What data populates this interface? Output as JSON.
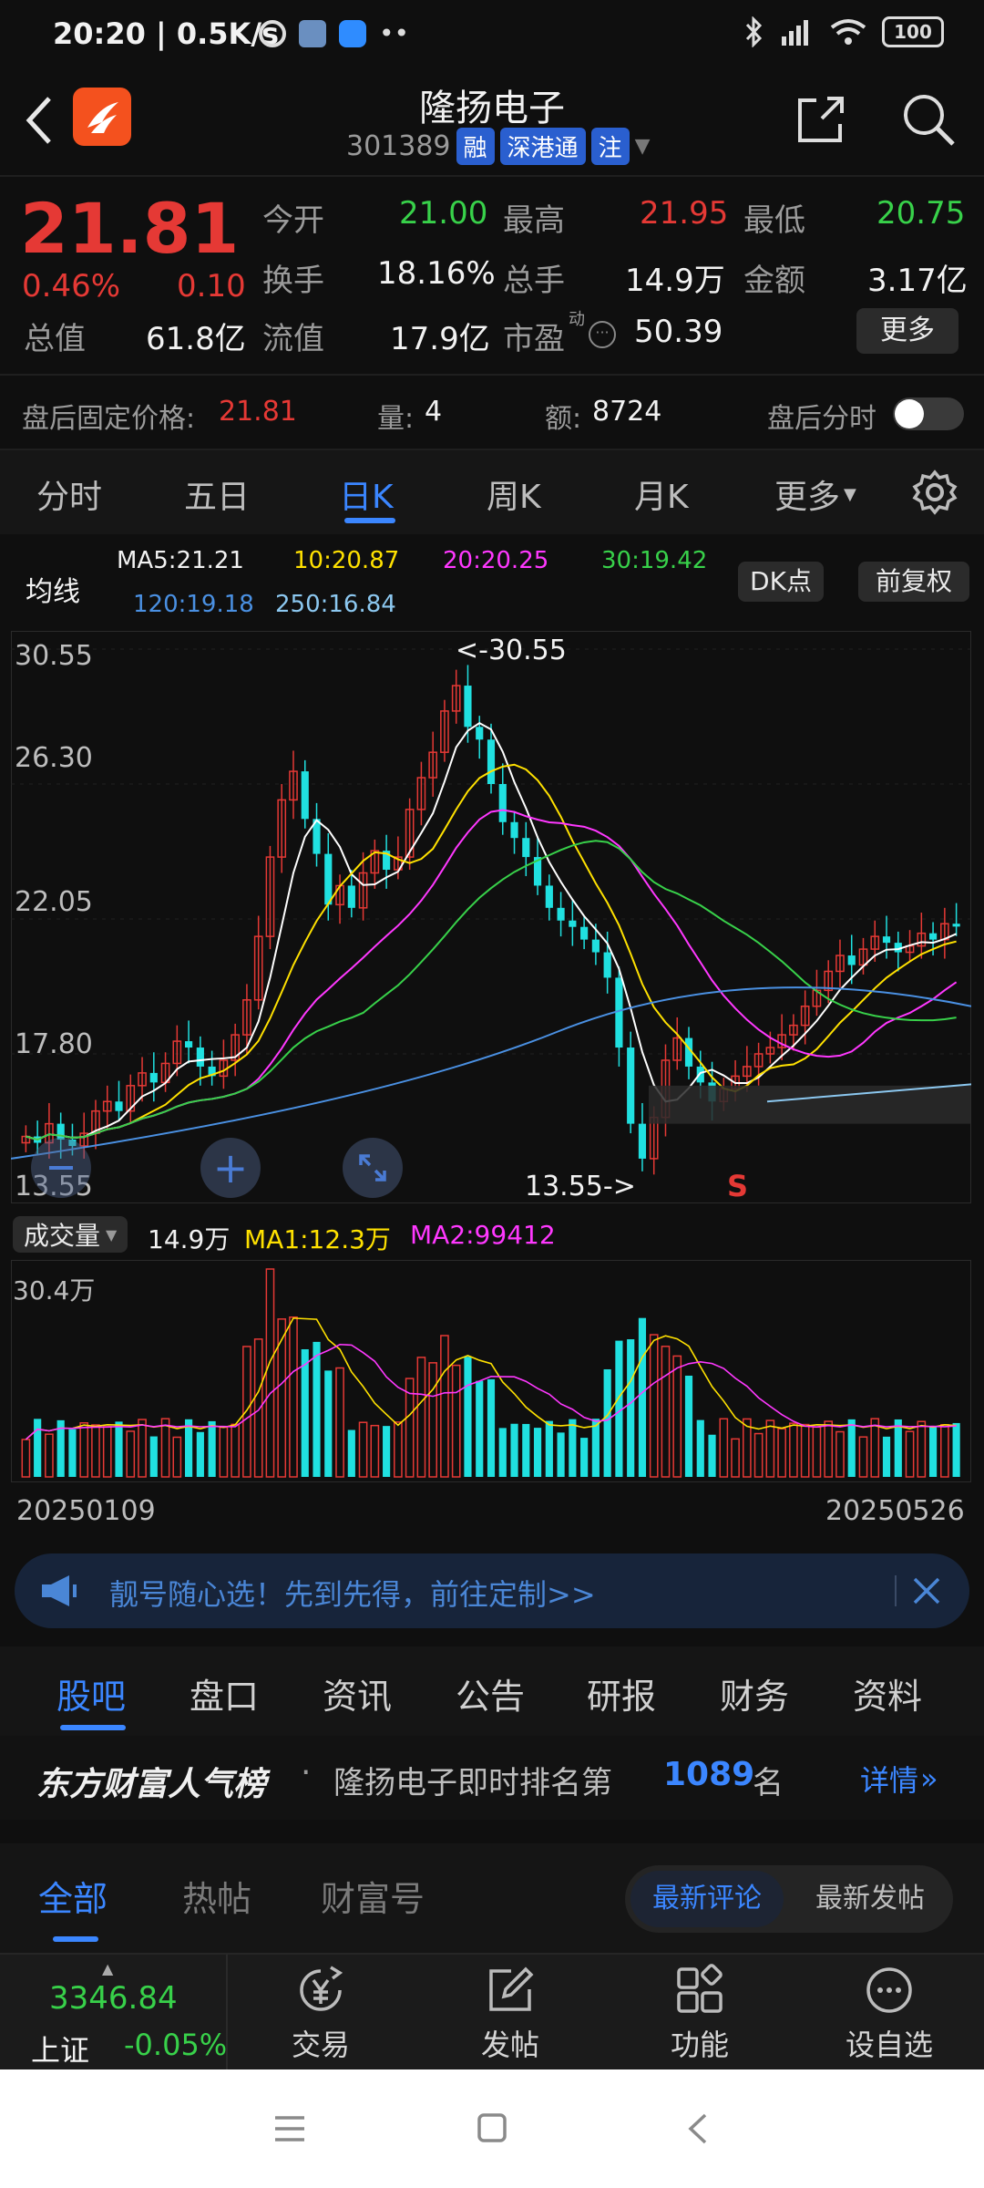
{
  "status_bar": {
    "time_speed": "20:20 | 0.5K/s",
    "battery": "100"
  },
  "header": {
    "title": "隆扬电子",
    "code": "301389",
    "badge_rong": "融",
    "badge_sgt": "深港通",
    "badge_zhu": "注"
  },
  "quote": {
    "price": "21.81",
    "pct": "0.46%",
    "chg": "0.10",
    "stats": {
      "open_label": "今开",
      "open": "21.00",
      "high_label": "最高",
      "high": "21.95",
      "low_label": "最低",
      "low": "20.75",
      "turnover_label": "换手",
      "turnover": "18.16%",
      "volume_label": "总手",
      "volume": "14.9万",
      "amount_label": "金额",
      "amount": "3.17亿",
      "mktcap_label": "总值",
      "mktcap": "61.8亿",
      "float_label": "流值",
      "float": "17.9亿",
      "pe_label": "市盈",
      "pe_sup": "动",
      "pe": "50.39",
      "more": "更多"
    }
  },
  "after_hours": {
    "label": "盘后固定价格:",
    "price": "21.81",
    "vol_label": "量:",
    "vol": "4",
    "amt_label": "额:",
    "amt": "8724",
    "toggle_label": "盘后分时"
  },
  "tabs": [
    "分时",
    "五日",
    "日K",
    "周K",
    "月K",
    "更多"
  ],
  "ma_legend": {
    "label": "均线",
    "ma5": "MA5:21.21",
    "ma10": "10:20.87",
    "ma20": "20:20.25",
    "ma30": "30:19.42",
    "ma120": "120:19.18",
    "ma250": "250:16.84",
    "dk_button": "DK点",
    "adj_button": "前复权"
  },
  "kchart": {
    "y_ticks": [
      "30.55",
      "26.30",
      "22.05",
      "17.80",
      "13.55"
    ],
    "high_annot": "<-30.55",
    "low_annot": "13.55->",
    "s_marker": "S"
  },
  "vol_legend": {
    "selector": "成交量",
    "vol": "14.9万",
    "ma1": "MA1:12.3万",
    "ma2": "MA2:99412",
    "max_tick": "30.4万"
  },
  "date_range": {
    "start": "20250109",
    "end": "20250526"
  },
  "ad_banner": {
    "text": "靓号随心选！先到先得，前往定制>>"
  },
  "section_tabs": [
    "股吧",
    "盘口",
    "资讯",
    "公告",
    "研报",
    "财务",
    "资料"
  ],
  "ranking": {
    "brand": "东方财富人气榜",
    "text": "隆扬电子即时排名第",
    "rank": "1089",
    "unit": "名",
    "detail": "详情"
  },
  "feed_tabs": [
    "全部",
    "热帖",
    "财富号"
  ],
  "sort_tabs": [
    "最新评论",
    "最新发帖"
  ],
  "bottom_nav": {
    "index_value": "3346.84",
    "index_name": "上证",
    "index_pct": "-0.05%",
    "items": [
      "交易",
      "发帖",
      "功能",
      "设自选"
    ]
  },
  "colors": {
    "up": "#e53935",
    "down": "#20e0e0",
    "accent": "#3b86ff"
  },
  "chart_data": {
    "type": "candlestick",
    "y_ticks": [
      30.55,
      26.3,
      22.05,
      17.8,
      13.55
    ],
    "ylim": [
      13.55,
      30.55
    ],
    "high_marker": 30.55,
    "low_marker": 13.55,
    "volume_max_label": "30.4万",
    "x_range": [
      "20250109",
      "20250526"
    ],
    "ma_values": {
      "MA5": 21.21,
      "MA10": 20.87,
      "MA20": 20.25,
      "MA30": 19.42,
      "MA120": 19.18,
      "MA250": 16.84
    }
  }
}
